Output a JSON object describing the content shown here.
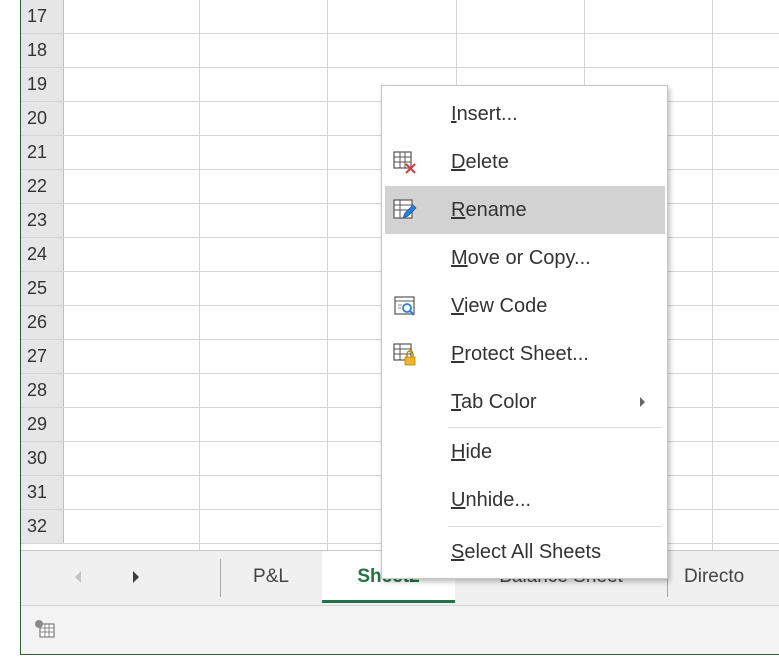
{
  "grid": {
    "rows": [
      "17",
      "18",
      "19",
      "20",
      "21",
      "22",
      "23",
      "24",
      "25",
      "26",
      "27",
      "28",
      "29",
      "30",
      "31",
      "32"
    ]
  },
  "sheet_tabs": {
    "items": [
      {
        "label": "P&L",
        "active": false
      },
      {
        "label": "Sheet2",
        "active": true
      },
      {
        "label": "Balance Sheet",
        "active": false
      },
      {
        "label": "Directo",
        "active": false
      }
    ]
  },
  "context_menu": {
    "items": [
      {
        "label_underline": "I",
        "label_rest": "nsert...",
        "icon": "",
        "highlighted": false
      },
      {
        "label_underline": "D",
        "label_rest": "elete",
        "icon": "delete-sheet-icon",
        "highlighted": false
      },
      {
        "label_underline": "R",
        "label_rest": "ename",
        "icon": "rename-sheet-icon",
        "highlighted": true
      },
      {
        "label_underline": "M",
        "label_rest": "ove or Copy...",
        "icon": "",
        "highlighted": false
      },
      {
        "label_underline": "V",
        "label_rest": "iew Code",
        "icon": "view-code-icon",
        "highlighted": false
      },
      {
        "label_underline": "P",
        "label_rest": "rotect Sheet...",
        "icon": "protect-sheet-icon",
        "highlighted": false
      },
      {
        "label_underline": "T",
        "label_rest": "ab Color",
        "icon": "",
        "highlighted": false,
        "submenu": true
      },
      {
        "label_underline": "H",
        "label_rest": "ide",
        "icon": "",
        "highlighted": false
      },
      {
        "label_underline": "U",
        "label_rest": "nhide...",
        "icon": "",
        "highlighted": false
      },
      {
        "label_underline": "S",
        "label_rest": "elect All Sheets",
        "icon": "",
        "highlighted": false
      }
    ]
  },
  "colors": {
    "accent": "#217346",
    "highlight": "#d2d2d2"
  }
}
